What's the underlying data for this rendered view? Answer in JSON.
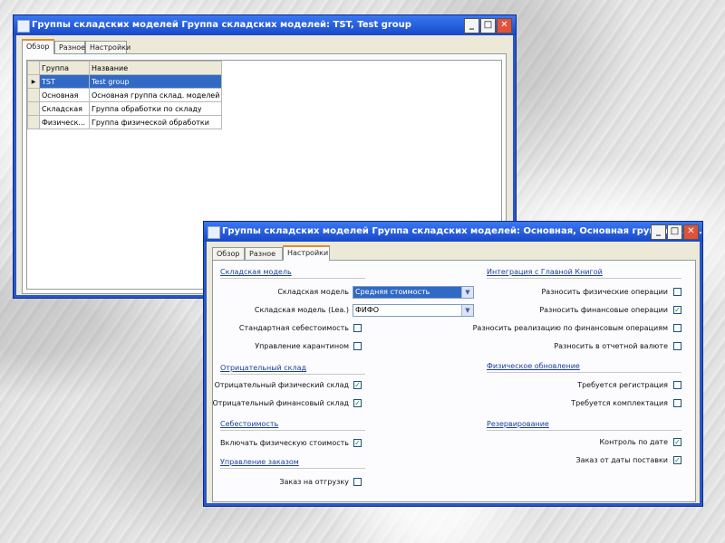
{
  "window1": {
    "title": "Группы складских моделей Группа складских моделей: TST, Test group",
    "tabs": [
      "Обзор",
      "Разное",
      "Настройки"
    ],
    "grid": {
      "columns": [
        "Группа",
        "Название"
      ],
      "rows": [
        {
          "group": "TST",
          "name": "Test group",
          "selected": true
        },
        {
          "group": "Основная",
          "name": "Основная группа склад. моделей",
          "selected": false
        },
        {
          "group": "Складская",
          "name": "Группа обработки по складу",
          "selected": false
        },
        {
          "group": "Физическ...",
          "name": "Группа физической обработки",
          "selected": false
        }
      ]
    }
  },
  "window2": {
    "title": "Группы складских моделей Группа складских моделей: Основная, Основная группа скла...",
    "tabs": [
      "Обзор",
      "Разное",
      "Настройки"
    ],
    "left": {
      "inventory_model": {
        "heading": "Складская модель",
        "model_label": "Складская модель",
        "model_value": "Средняя стоимость",
        "model_leu_label": "Складская модель (Lea.)",
        "model_leu_value": "ФИФО",
        "standard_cost_label": "Стандартная себестоимость",
        "quarantine_label": "Управление карантином"
      },
      "negative_stock": {
        "heading": "Отрицательный склад",
        "physical_label": "Отрицательный физический склад",
        "financial_label": "Отрицательный финансовый склад"
      },
      "cost_price": {
        "heading": "Себестоимость",
        "include_physical_label": "Включать физическую стоимость"
      },
      "order_management": {
        "heading": "Управление заказом",
        "shipment_order_label": "Заказ на отгрузку"
      }
    },
    "right": {
      "gl_integration": {
        "heading": "Интеграция с Главной Книгой",
        "post_physical_label": "Разносить физические операции",
        "post_financial_label": "Разносить финансовые операции",
        "post_realized_label": "Разносить реализацию по финансовым операциям",
        "post_foreign_label": "Разносить в отчетной валюте"
      },
      "physical_update": {
        "heading": "Физическое обновление",
        "registration_label": "Требуется регистрация",
        "picking_label": "Требуется комплектация"
      },
      "reservation": {
        "heading": "Резервирование",
        "date_control_label": "Контроль по дате",
        "delivery_date_label": "Заказ от даты поставки"
      }
    },
    "checkbox_states": {
      "standard_cost": false,
      "quarantine": false,
      "neg_physical": true,
      "neg_financial": true,
      "include_physical": true,
      "shipment_order": false,
      "post_physical": false,
      "post_financial": true,
      "post_realized": false,
      "post_foreign": false,
      "registration": false,
      "picking": false,
      "date_control": true,
      "delivery_date": true
    }
  }
}
